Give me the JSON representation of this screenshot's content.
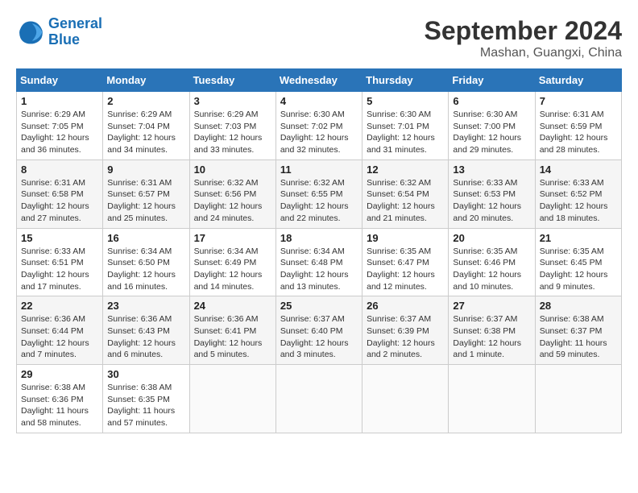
{
  "header": {
    "logo_line1": "General",
    "logo_line2": "Blue",
    "month": "September 2024",
    "location": "Mashan, Guangxi, China"
  },
  "weekdays": [
    "Sunday",
    "Monday",
    "Tuesday",
    "Wednesday",
    "Thursday",
    "Friday",
    "Saturday"
  ],
  "weeks": [
    [
      {
        "day": "1",
        "sunrise": "6:29 AM",
        "sunset": "7:05 PM",
        "daylight": "12 hours and 36 minutes."
      },
      {
        "day": "2",
        "sunrise": "6:29 AM",
        "sunset": "7:04 PM",
        "daylight": "12 hours and 34 minutes."
      },
      {
        "day": "3",
        "sunrise": "6:29 AM",
        "sunset": "7:03 PM",
        "daylight": "12 hours and 33 minutes."
      },
      {
        "day": "4",
        "sunrise": "6:30 AM",
        "sunset": "7:02 PM",
        "daylight": "12 hours and 32 minutes."
      },
      {
        "day": "5",
        "sunrise": "6:30 AM",
        "sunset": "7:01 PM",
        "daylight": "12 hours and 31 minutes."
      },
      {
        "day": "6",
        "sunrise": "6:30 AM",
        "sunset": "7:00 PM",
        "daylight": "12 hours and 29 minutes."
      },
      {
        "day": "7",
        "sunrise": "6:31 AM",
        "sunset": "6:59 PM",
        "daylight": "12 hours and 28 minutes."
      }
    ],
    [
      {
        "day": "8",
        "sunrise": "6:31 AM",
        "sunset": "6:58 PM",
        "daylight": "12 hours and 27 minutes."
      },
      {
        "day": "9",
        "sunrise": "6:31 AM",
        "sunset": "6:57 PM",
        "daylight": "12 hours and 25 minutes."
      },
      {
        "day": "10",
        "sunrise": "6:32 AM",
        "sunset": "6:56 PM",
        "daylight": "12 hours and 24 minutes."
      },
      {
        "day": "11",
        "sunrise": "6:32 AM",
        "sunset": "6:55 PM",
        "daylight": "12 hours and 22 minutes."
      },
      {
        "day": "12",
        "sunrise": "6:32 AM",
        "sunset": "6:54 PM",
        "daylight": "12 hours and 21 minutes."
      },
      {
        "day": "13",
        "sunrise": "6:33 AM",
        "sunset": "6:53 PM",
        "daylight": "12 hours and 20 minutes."
      },
      {
        "day": "14",
        "sunrise": "6:33 AM",
        "sunset": "6:52 PM",
        "daylight": "12 hours and 18 minutes."
      }
    ],
    [
      {
        "day": "15",
        "sunrise": "6:33 AM",
        "sunset": "6:51 PM",
        "daylight": "12 hours and 17 minutes."
      },
      {
        "day": "16",
        "sunrise": "6:34 AM",
        "sunset": "6:50 PM",
        "daylight": "12 hours and 16 minutes."
      },
      {
        "day": "17",
        "sunrise": "6:34 AM",
        "sunset": "6:49 PM",
        "daylight": "12 hours and 14 minutes."
      },
      {
        "day": "18",
        "sunrise": "6:34 AM",
        "sunset": "6:48 PM",
        "daylight": "12 hours and 13 minutes."
      },
      {
        "day": "19",
        "sunrise": "6:35 AM",
        "sunset": "6:47 PM",
        "daylight": "12 hours and 12 minutes."
      },
      {
        "day": "20",
        "sunrise": "6:35 AM",
        "sunset": "6:46 PM",
        "daylight": "12 hours and 10 minutes."
      },
      {
        "day": "21",
        "sunrise": "6:35 AM",
        "sunset": "6:45 PM",
        "daylight": "12 hours and 9 minutes."
      }
    ],
    [
      {
        "day": "22",
        "sunrise": "6:36 AM",
        "sunset": "6:44 PM",
        "daylight": "12 hours and 7 minutes."
      },
      {
        "day": "23",
        "sunrise": "6:36 AM",
        "sunset": "6:43 PM",
        "daylight": "12 hours and 6 minutes."
      },
      {
        "day": "24",
        "sunrise": "6:36 AM",
        "sunset": "6:41 PM",
        "daylight": "12 hours and 5 minutes."
      },
      {
        "day": "25",
        "sunrise": "6:37 AM",
        "sunset": "6:40 PM",
        "daylight": "12 hours and 3 minutes."
      },
      {
        "day": "26",
        "sunrise": "6:37 AM",
        "sunset": "6:39 PM",
        "daylight": "12 hours and 2 minutes."
      },
      {
        "day": "27",
        "sunrise": "6:37 AM",
        "sunset": "6:38 PM",
        "daylight": "12 hours and 1 minute."
      },
      {
        "day": "28",
        "sunrise": "6:38 AM",
        "sunset": "6:37 PM",
        "daylight": "11 hours and 59 minutes."
      }
    ],
    [
      {
        "day": "29",
        "sunrise": "6:38 AM",
        "sunset": "6:36 PM",
        "daylight": "11 hours and 58 minutes."
      },
      {
        "day": "30",
        "sunrise": "6:38 AM",
        "sunset": "6:35 PM",
        "daylight": "11 hours and 57 minutes."
      },
      null,
      null,
      null,
      null,
      null
    ]
  ]
}
